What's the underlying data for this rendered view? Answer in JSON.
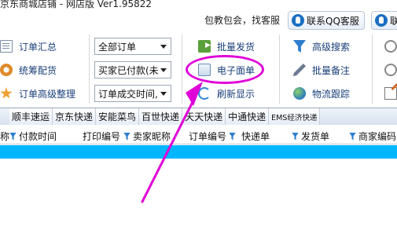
{
  "window": {
    "title": "京东商城店铺 - 网店版 Ver1.95822"
  },
  "banner": {
    "message": "包教包会，找客服",
    "qq_button_1": "联系QQ客服",
    "qq_button_2": "联"
  },
  "toolbar": {
    "col1": [
      "订单汇总",
      "统筹配货",
      "订单高级整理"
    ],
    "filters": [
      "全部订单",
      "买家已付款(未",
      "订单成交时间,"
    ],
    "col2": [
      "批量发货",
      "电子面单",
      "刷新显示"
    ],
    "col3": [
      "高级搜索",
      "批量备注",
      "物流跟踪"
    ]
  },
  "courier_tabs": [
    "顺丰速运",
    "京东快递",
    "安能菜鸟",
    "百世快递",
    "天天快递",
    "中通快递",
    "EMS经济快递"
  ],
  "grid": {
    "columns": [
      "称",
      "付款时间",
      "打印编号",
      "卖家昵称",
      "订单编号",
      "快递单",
      "发货单",
      "商家编码"
    ]
  },
  "annotation": {
    "color": "#e000d8"
  }
}
